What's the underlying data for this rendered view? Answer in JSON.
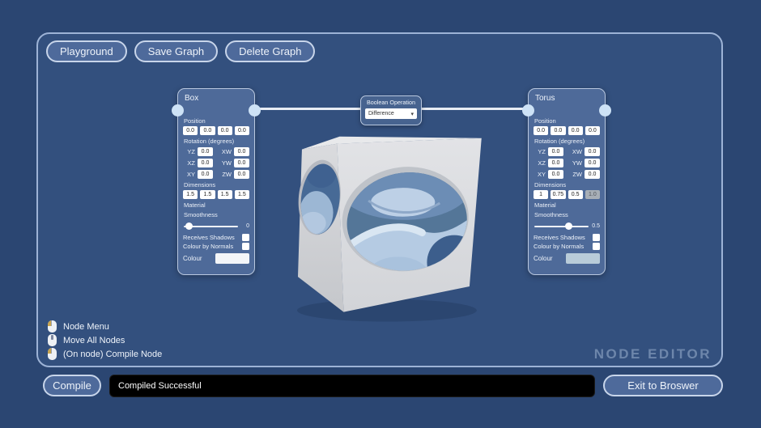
{
  "colors": {
    "page_bg": "#2b4672",
    "canvas_bg": "#33507e",
    "node_bg": "#4e6a99",
    "wire": "#e8edf4",
    "port": "#cde2f6",
    "status_bg": "#000000",
    "cube_gray": "#dcdde0",
    "torus_blue": "#b5cbe3"
  },
  "icons": {
    "chevron_down_glyph": "▾"
  },
  "toolbar": {
    "buttons": [
      {
        "label": "Playground"
      },
      {
        "label": "Save Graph"
      },
      {
        "label": "Delete Graph"
      }
    ]
  },
  "nodes": {
    "box": {
      "title": "Box",
      "position_label": "Position",
      "position_values": [
        "0.0",
        "0.0",
        "0.0",
        "0.0"
      ],
      "rotation_label": "Rotation (degrees)",
      "rotation_rows": [
        {
          "l1": "YZ",
          "v1": "0.0",
          "l2": "XW",
          "v2": "0.0"
        },
        {
          "l1": "XZ",
          "v1": "0.0",
          "l2": "YW",
          "v2": "0.0"
        },
        {
          "l1": "XY",
          "v1": "0.0",
          "l2": "ZW",
          "v2": "0.0"
        }
      ],
      "dimensions_label": "Dimensions",
      "dimensions_values": [
        "1.5",
        "1.5",
        "1.5",
        "1.5"
      ],
      "material_label": "Material",
      "smoothness_label": "Smoothness",
      "smoothness_value": "0",
      "smoothness_pos": "4%",
      "receives_shadows_label": "Receives Shadows",
      "colour_by_normals_label": "Colour by Normals",
      "colour_label": "Colour",
      "colour_value": "#f3f5f8"
    },
    "torus": {
      "title": "Torus",
      "position_label": "Position",
      "position_values": [
        "0.0",
        "0.0",
        "0.0",
        "0.0"
      ],
      "rotation_label": "Rotation (degrees)",
      "rotation_rows": [
        {
          "l1": "YZ",
          "v1": "0.0",
          "l2": "XW",
          "v2": "0.0"
        },
        {
          "l1": "XZ",
          "v1": "0.0",
          "l2": "YW",
          "v2": "0.0"
        },
        {
          "l1": "XY",
          "v1": "0.0",
          "l2": "ZW",
          "v2": "0.0"
        }
      ],
      "dimensions_label": "Dimensions",
      "dimensions_values": [
        "1",
        "0.75",
        "0.5",
        "1.0"
      ],
      "material_label": "Material",
      "smoothness_label": "Smoothness",
      "smoothness_value": "0.5",
      "smoothness_pos": "47%",
      "receives_shadows_label": "Receives Shadows",
      "colour_by_normals_label": "Colour by Normals",
      "colour_label": "Colour",
      "colour_value": "#b9ccd9"
    },
    "boolean": {
      "title": "Boolean Operation",
      "selected_option": "Difference"
    }
  },
  "legend": {
    "items": [
      {
        "icon": "mouse-left-button-icon",
        "label": "Node Menu"
      },
      {
        "icon": "mouse-scroll-wheel-icon",
        "label": "Move All Nodes"
      },
      {
        "icon": "mouse-left-button-icon",
        "label": "(On node) Compile Node"
      }
    ]
  },
  "watermark": "NODE EDITOR",
  "bottombar": {
    "compile_label": "Compile",
    "status_text": "Compiled Successful",
    "exit_label": "Exit to Broswer"
  }
}
